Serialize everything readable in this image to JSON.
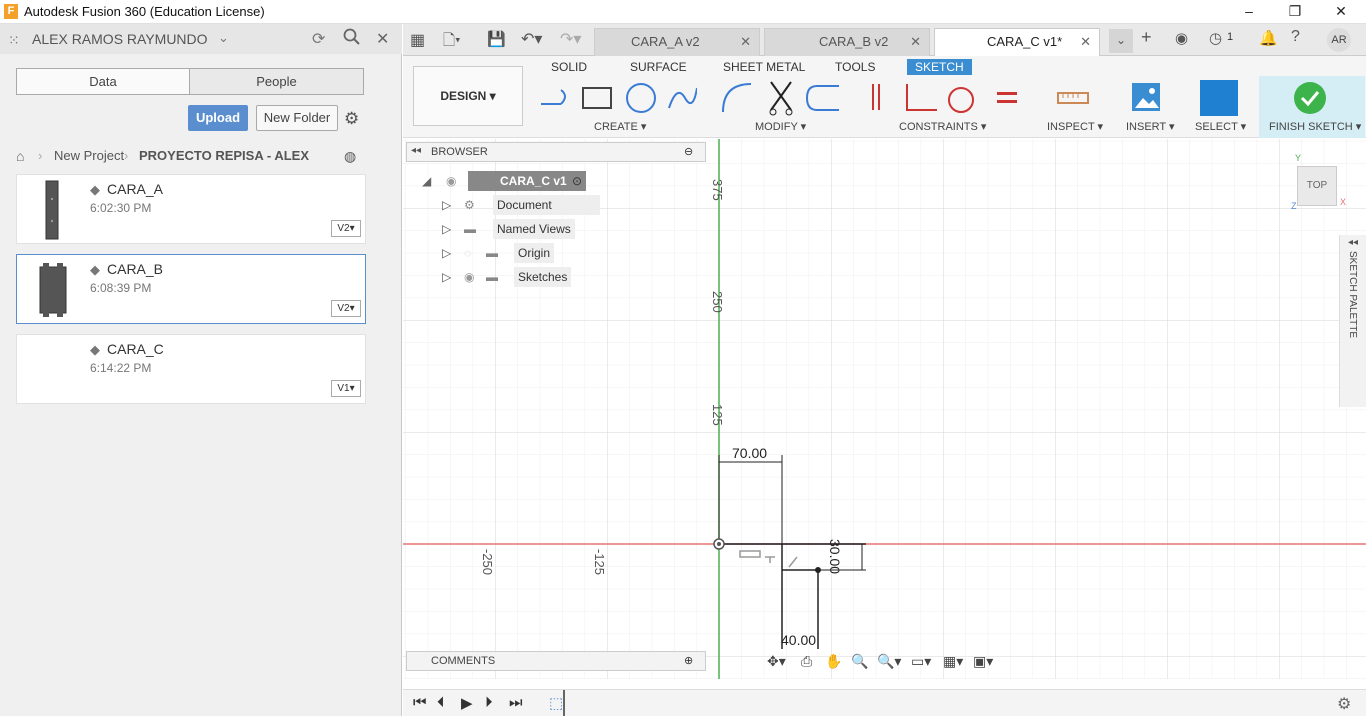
{
  "window": {
    "title": "Autodesk Fusion 360 (Education License)",
    "logo": "F"
  },
  "datapanel": {
    "user": "ALEX RAMOS RAYMUNDO",
    "tabs": [
      "Data",
      "People"
    ],
    "upload": "Upload",
    "new_folder": "New Folder",
    "breadcrumb": {
      "project": "New Project",
      "folder": "PROYECTO REPISA - ALEX"
    },
    "files": [
      {
        "name": "CARA_A",
        "time": "6:02:30 PM",
        "version": "V2"
      },
      {
        "name": "CARA_B",
        "time": "6:08:39 PM",
        "version": "V2"
      },
      {
        "name": "CARA_C",
        "time": "6:14:22 PM",
        "version": "V1"
      }
    ]
  },
  "doc_tabs": [
    {
      "label": "CARA_A v2"
    },
    {
      "label": "CARA_B v2"
    },
    {
      "label": "CARA_C v1*"
    }
  ],
  "header": {
    "jobs_count": "1",
    "user_initials": "AR"
  },
  "toolbar": {
    "workspace": "DESIGN",
    "tabs": [
      "SOLID",
      "SURFACE",
      "SHEET METAL",
      "TOOLS",
      "SKETCH"
    ],
    "groups": [
      "CREATE",
      "MODIFY",
      "CONSTRAINTS",
      "INSPECT",
      "INSERT",
      "SELECT",
      "FINISH SKETCH"
    ]
  },
  "browser": {
    "title": "BROWSER",
    "root": "CARA_C v1",
    "items": [
      "Document Settings",
      "Named Views",
      "Origin",
      "Sketches"
    ]
  },
  "comments": {
    "title": "COMMENTS"
  },
  "viewcube": {
    "label": "TOP",
    "x": "X",
    "y": "Y",
    "z": "Z"
  },
  "sketch_palette": "SKETCH PALETTE",
  "canvas": {
    "axis_labels": [
      "375",
      "250",
      "125",
      "-250",
      "-125"
    ],
    "dimensions": [
      "70.00",
      "30.00",
      "40.00"
    ]
  }
}
